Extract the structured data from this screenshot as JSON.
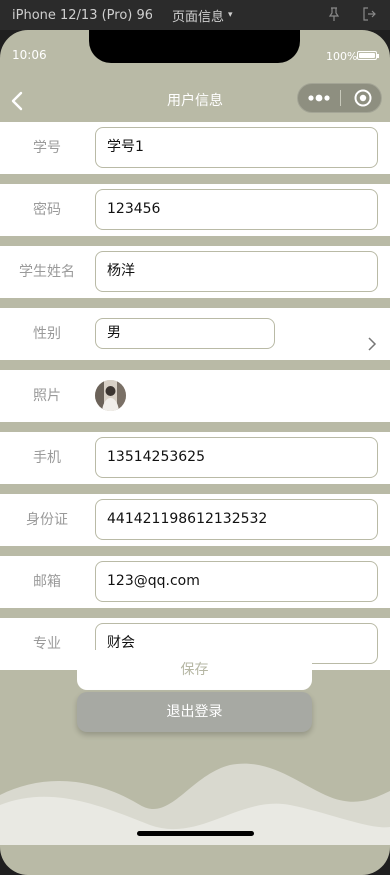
{
  "devtools": {
    "device": "iPhone 12/13 (Pro) 96...",
    "page_info": "页面信息"
  },
  "status": {
    "time": "10:06",
    "battery": "100%"
  },
  "nav": {
    "title": "用户信息"
  },
  "form": {
    "student_id": {
      "label": "学号",
      "value": "学号1"
    },
    "password": {
      "label": "密码",
      "value": "123456"
    },
    "name": {
      "label": "学生姓名",
      "value": "杨洋"
    },
    "gender": {
      "label": "性别",
      "value": "男"
    },
    "photo": {
      "label": "照片"
    },
    "phone": {
      "label": "手机",
      "value": "13514253625"
    },
    "id_card": {
      "label": "身份证",
      "value": "441421198612132532"
    },
    "email": {
      "label": "邮箱",
      "value": "123@qq.com"
    },
    "major": {
      "label": "专业",
      "value": "财会"
    }
  },
  "buttons": {
    "save": "保存",
    "logout": "退出登录"
  },
  "colors": {
    "background": "#b9baa6",
    "field_border": "#b9baa6",
    "logout_button": "#a7a9a3"
  }
}
